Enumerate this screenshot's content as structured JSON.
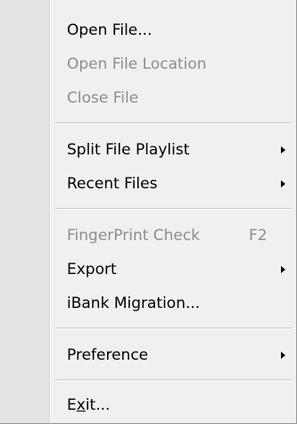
{
  "menu": {
    "open_file": "Open File...",
    "open_file_location": "Open File Location",
    "close_file": "Close File",
    "split_file_playlist": "Split File Playlist",
    "recent_files": "Recent Files",
    "fingerprint_check": "FingerPrint Check",
    "fingerprint_shortcut": "F2",
    "export": "Export",
    "ibank_migration": "iBank Migration...",
    "preference": "Preference",
    "exit_pre": "E",
    "exit_mnemonic": "x",
    "exit_post": "it..."
  },
  "icons": {
    "submenu": "submenu-arrow-icon"
  },
  "colors": {
    "background": "#f0f0f0",
    "gutter": "#e4e4e4",
    "disabled_text": "#8d8d8d",
    "text": "#000000"
  }
}
